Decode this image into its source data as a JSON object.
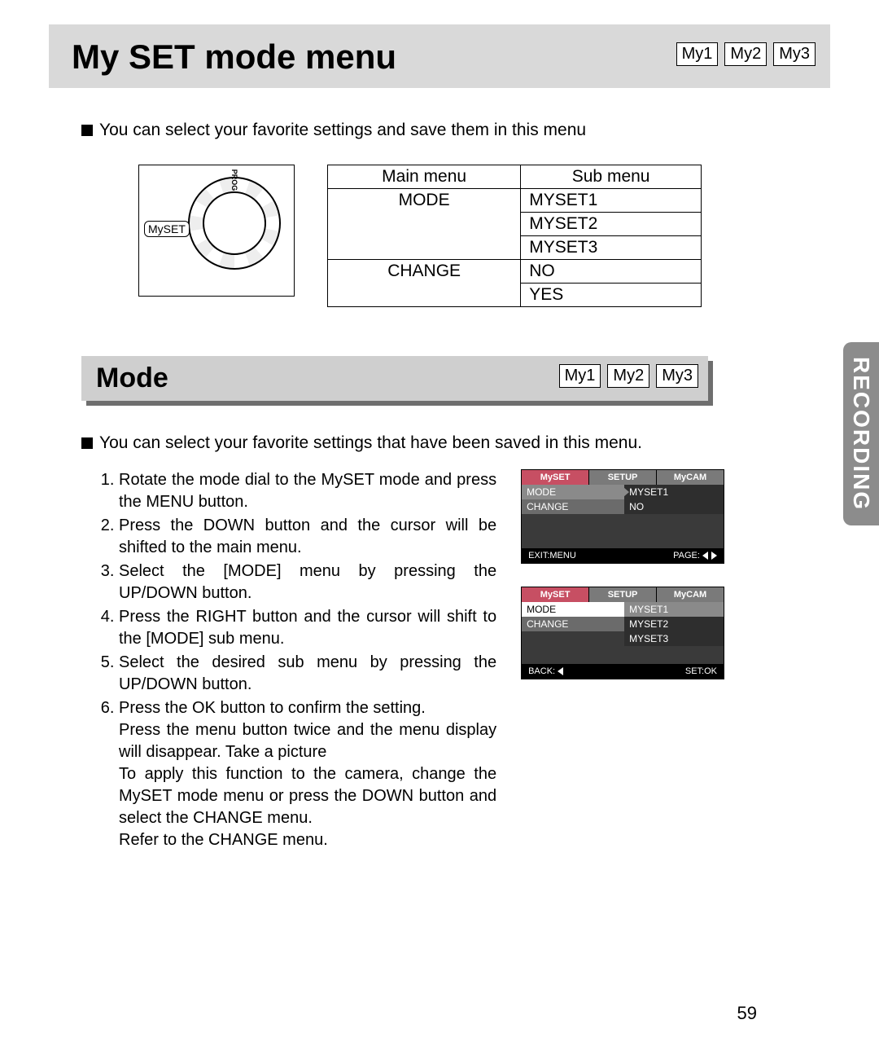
{
  "header": {
    "title": "My SET mode menu",
    "badges": [
      "My1",
      "My2",
      "My3"
    ]
  },
  "intro": "You can select your favorite settings and save them in this menu",
  "dial_label": "MySET",
  "table": {
    "head": [
      "Main menu",
      "Sub menu"
    ],
    "rows": [
      {
        "main": "MODE",
        "subs": [
          "MYSET1",
          "MYSET2",
          "MYSET3"
        ]
      },
      {
        "main": "CHANGE",
        "subs": [
          "NO",
          "YES"
        ]
      }
    ]
  },
  "mode_section": {
    "title": "Mode",
    "badges": [
      "My1",
      "My2",
      "My3"
    ],
    "intro": "You can select your favorite settings that have been saved in this menu.",
    "steps": [
      "Rotate the mode dial to the MySET mode and press the MENU button.",
      "Press the DOWN button and the cursor will be shifted to the main menu.",
      "Select the [MODE] menu by pressing the UP/DOWN button.",
      "Press the RIGHT button and the cursor will shift to the [MODE] sub menu.",
      "Select the desired sub menu by pressing the UP/DOWN button.",
      "Press the OK button to confirm the setting.\nPress the menu button twice and the menu display will disappear. Take a picture\nTo apply this function to the camera, change the MySET mode menu or press the DOWN button and select the CHANGE menu.\nRefer to the CHANGE menu."
    ]
  },
  "lcd1": {
    "tabs": [
      "MySET",
      "SETUP",
      "MyCAM"
    ],
    "rows": [
      {
        "left": "MODE",
        "right": "MYSET1",
        "left_sel": true,
        "right_sel": false
      },
      {
        "left": "CHANGE",
        "right": "NO",
        "left_sel": false,
        "right_sel": false
      }
    ],
    "foot_left": "EXIT:MENU",
    "foot_right": "PAGE:"
  },
  "lcd2": {
    "tabs": [
      "MySET",
      "SETUP",
      "MyCAM"
    ],
    "rows": [
      {
        "left": "MODE",
        "right": "MYSET1",
        "left_sel": false,
        "right_sel": true
      },
      {
        "left": "CHANGE",
        "right": "MYSET2",
        "left_sel": false,
        "right_sel": false
      },
      {
        "left": "",
        "right": "MYSET3",
        "left_sel": false,
        "right_sel": false
      }
    ],
    "foot_left": "BACK:",
    "foot_right": "SET:OK"
  },
  "side_tab": "RECORDING",
  "page_number": "59"
}
